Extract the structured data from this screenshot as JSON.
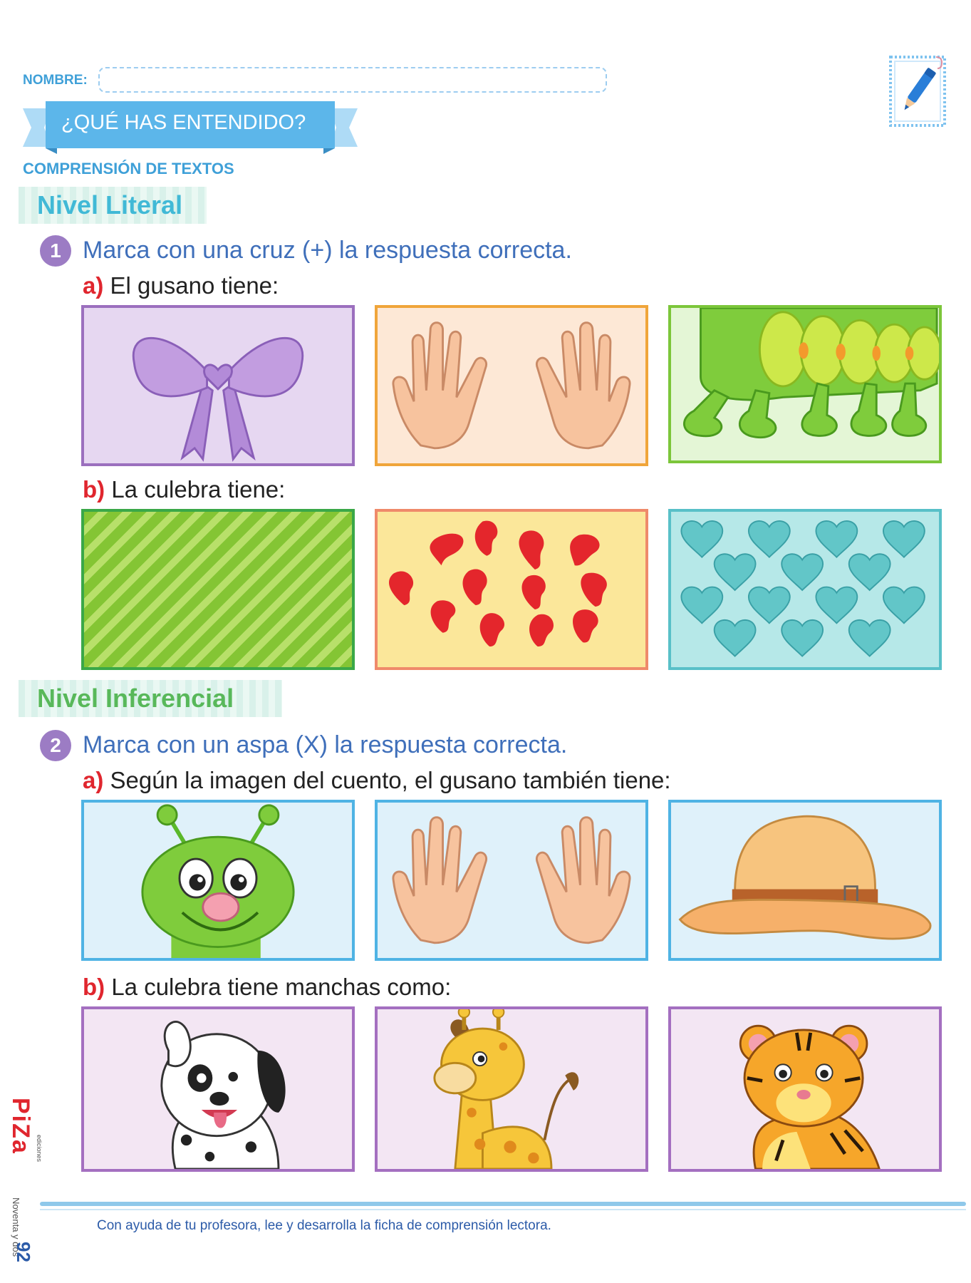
{
  "header": {
    "name_label": "NOMBRE:",
    "banner_title": "¿QUÉ HAS ENTENDIDO?",
    "section": "COMPRENSIÓN DE TEXTOS"
  },
  "level1": {
    "title": "Nivel Literal",
    "number": "1",
    "instruction": "Marca con una cruz (+) la respuesta correcta.",
    "q_a_letter": "a)",
    "q_a_text": "El gusano tiene:",
    "q_b_letter": "b)",
    "q_b_text": "La culebra tiene:"
  },
  "level2": {
    "title": "Nivel Inferencial",
    "number": "2",
    "instruction": "Marca con un aspa (X) la respuesta correcta.",
    "q_a_letter": "a)",
    "q_a_text": "Según la imagen del cuento, el gusano también tiene:",
    "q_b_letter": "b)",
    "q_b_text": "La culebra tiene manchas como:"
  },
  "footer": {
    "instruction": "Con ayuda de tu profesora, lee y desarrolla la ficha de comprensión lectora.",
    "page_number": "92",
    "page_words": "Noventa y dos",
    "logo": "PiZa",
    "logo_sub": "ediciones"
  },
  "colors": {
    "accent_blue": "#3fa0d8",
    "number_purple": "#9c7cc4",
    "letter_red": "#e0262e",
    "instruction_blue": "#3f6fba"
  },
  "option_icons": {
    "row1": [
      "bow-icon",
      "hands-icon",
      "caterpillar-legs-icon"
    ],
    "row2": [
      "stripes-pattern",
      "red-spots-pattern",
      "hearts-pattern"
    ],
    "row3": [
      "worm-face-icon",
      "hands-icon",
      "hat-icon"
    ],
    "row4": [
      "dalmatian-icon",
      "giraffe-icon",
      "tiger-icon"
    ]
  }
}
